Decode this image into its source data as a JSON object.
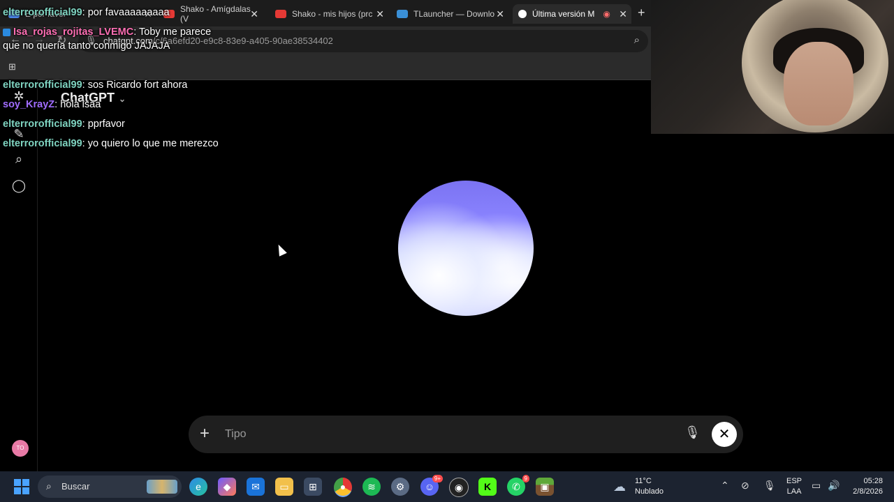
{
  "browser": {
    "tabs": [
      {
        "label": "E por favor",
        "color": "#4d8af0"
      },
      {
        "label": "Shako - Amígdalas (V",
        "color": "#e53935"
      },
      {
        "label": "Shako - mis hijos (prc",
        "color": "#e53935"
      },
      {
        "label": "TLauncher — Downlo",
        "color": "#3a8fd6"
      },
      {
        "label": "Última versión M",
        "color": "#ffffff"
      }
    ],
    "url": "chatgpt.com",
    "url_path": "/c/6a6efd20-e9c8-83e9-a405-90ae38534402"
  },
  "app": {
    "model_name": "ChatGPT",
    "input_placeholder": "Tipo",
    "avatar_initials": "TO"
  },
  "chat_overlay": [
    {
      "user": "elterrorofficial99",
      "text": ": por favaaaaaaaaa",
      "style": ""
    },
    {
      "user": "Isa_rojas_rojitas_LVEMC",
      "text": ": Toby me parece que no quería tanto conmigo JAJAJA",
      "style": "pink"
    },
    {
      "user": "elterrorofficial99",
      "text": ": sos Ricardo fort ahora",
      "style": ""
    },
    {
      "user": "soy_KrayZ",
      "text": ": hola isaa",
      "style": "purple"
    },
    {
      "user": "elterrorofficial99",
      "text": ": pprfavor",
      "style": ""
    },
    {
      "user": "elterrorofficial99",
      "text": ": yo quiero lo que me merezco",
      "style": ""
    }
  ],
  "taskbar": {
    "search_label": "Buscar",
    "discord_badge": "9+",
    "whatsapp_badge": "9",
    "weather_temp": "11°C",
    "weather_desc": "Nublado",
    "lang_line1": "ESP",
    "lang_line2": "LAA",
    "time": "05:28",
    "date": "2/8/2026"
  }
}
